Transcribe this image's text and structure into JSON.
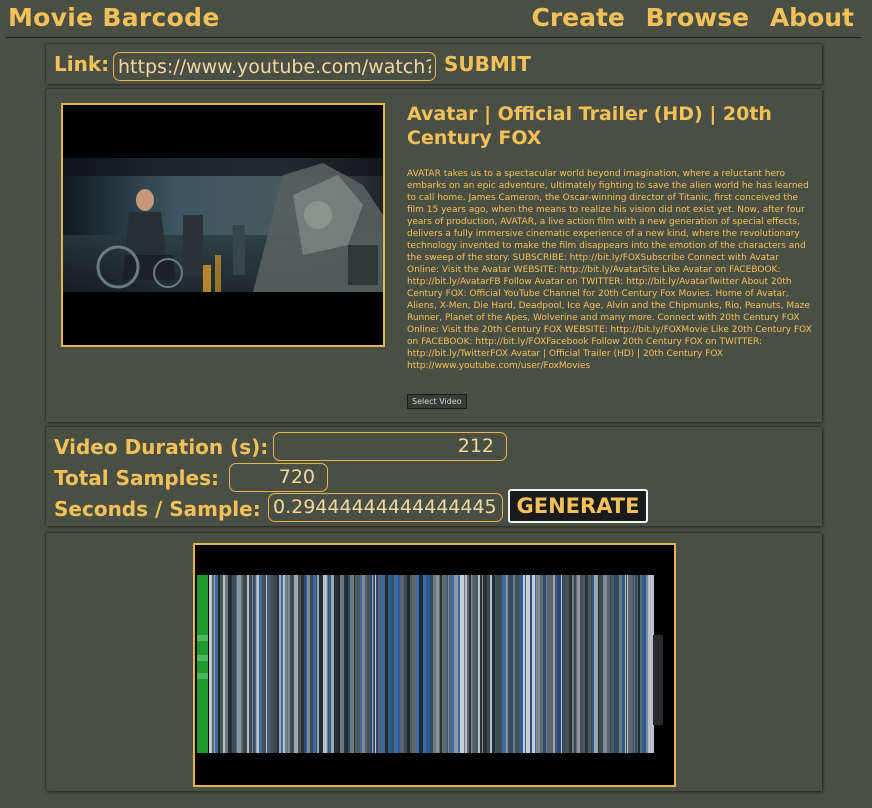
{
  "header": {
    "brand": "Movie Barcode",
    "nav": [
      "Create",
      "Browse",
      "About"
    ]
  },
  "link_form": {
    "label": "Link:",
    "url_value": "https://www.youtube.com/watch?v",
    "submit_label": "SUBMIT"
  },
  "video": {
    "title": "Avatar | Official Trailer (HD) | 20th Century FOX",
    "description": "AVATAR takes us to a spectacular world beyond imagination, where a reluctant hero embarks on an epic adventure, ultimately fighting to save the alien world he has learned to call home. James Cameron, the Oscar-winning director of Titanic, first conceived the film 15 years ago, when the means to realize his vision did not exist yet. Now, after four years of production, AVATAR, a live action film with a new generation of special effects, delivers a fully immersive cinematic experience of a new kind, where the revolutionary technology invented to make the film disappears into the emotion of the characters and the sweep of the story. SUBSCRIBE: http://bit.ly/FOXSubscribe Connect with Avatar Online: Visit the Avatar WEBSITE: http://bit.ly/AvatarSite Like Avatar on FACEBOOK: http://bit.ly/AvatarFB Follow Avatar on TWITTER: http://bit.ly/AvatarTwitter About 20th Century FOX: Official YouTube Channel for 20th Century Fox Movies. Home of Avatar, Aliens, X-Men, Die Hard, Deadpool, Ice Age, Alvin and the Chipmunks, Rio, Peanuts, Maze Runner, Planet of the Apes, Wolverine and many more. Connect with 20th Century FOX Online: Visit the 20th Century FOX WEBSITE: http://bit.ly/FOXMovie Like 20th Century FOX on FACEBOOK: http://bit.ly/FOXFacebook Follow 20th Century FOX on TWITTER: http://bit.ly/TwitterFOX Avatar | Official Trailer (HD) | 20th Century FOX http://www.youtube.com/user/FoxMovies",
    "select_label": "Select Video"
  },
  "settings": {
    "duration_label": "Video Duration (s):",
    "duration_value": "212",
    "samples_label": "Total Samples:",
    "samples_value": "720",
    "sps_label": "Seconds / Sample:",
    "sps_value": "0.29444444444444445",
    "generate_label": "GENERATE"
  },
  "colors": {
    "background": "#4a4f44",
    "accent": "#f2c15a",
    "border": "#e6b354"
  }
}
